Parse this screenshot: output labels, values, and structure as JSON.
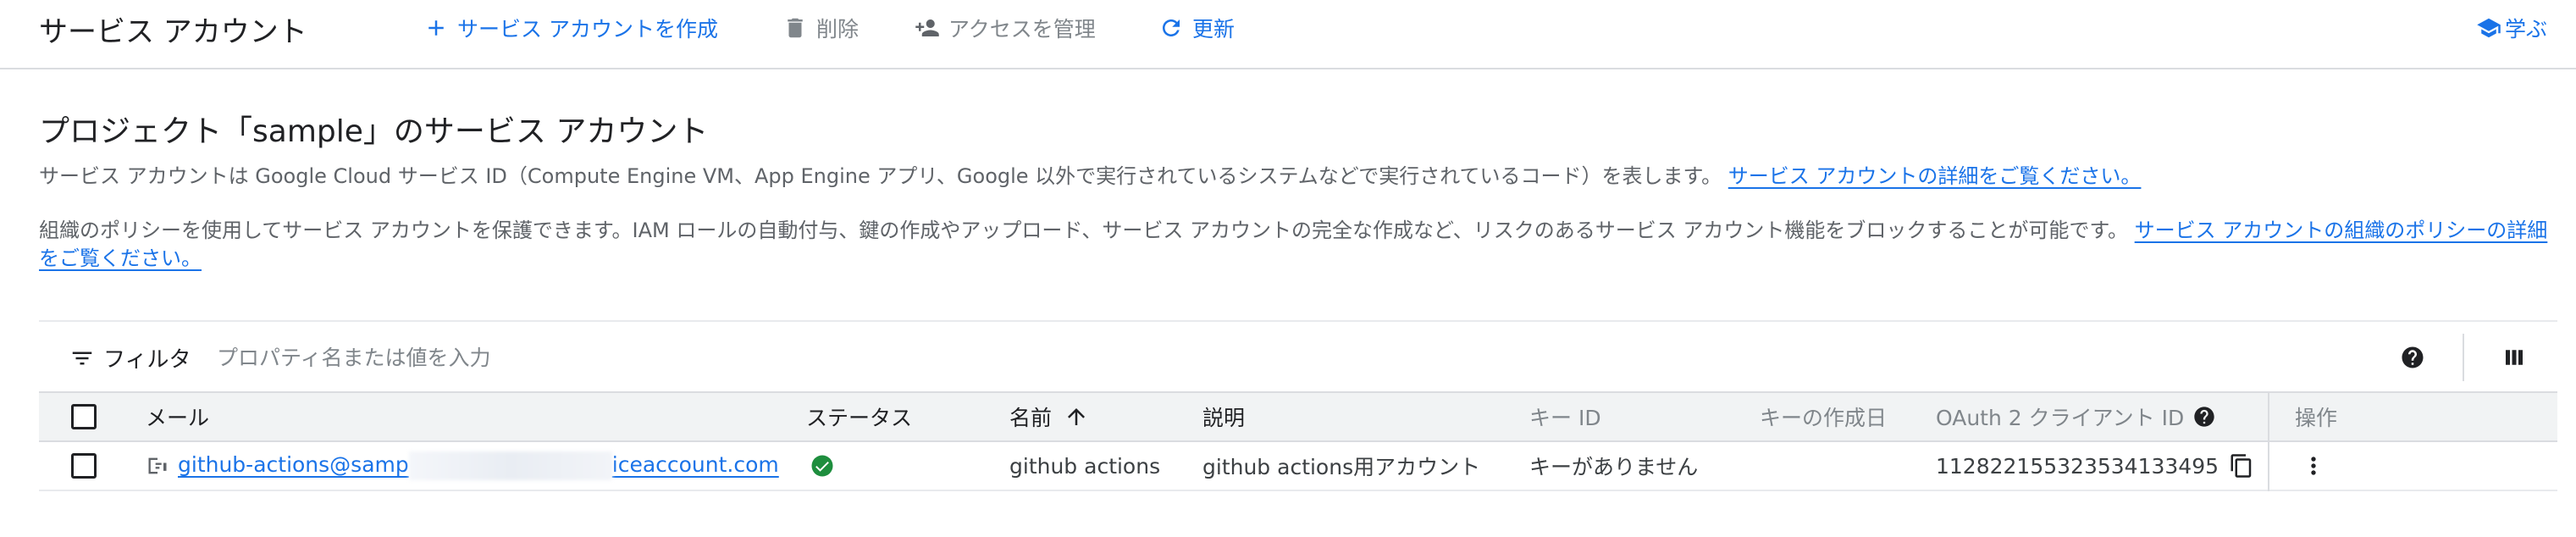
{
  "header": {
    "title": "サービス アカウント",
    "create_label": "サービス アカウントを作成",
    "delete_label": "削除",
    "manage_access_label": "アクセスを管理",
    "refresh_label": "更新",
    "learn_label": "学ぶ"
  },
  "main": {
    "heading": "プロジェクト「sample」のサービス アカウント",
    "description1": "サービス アカウントは Google Cloud サービス ID（Compute Engine VM、App Engine アプリ、Google 以外で実行されているシステムなどで実行されているコード）を表します。",
    "link1": "サービス アカウントの詳細をご覧ください。",
    "description2": "組織のポリシーを使用してサービス アカウントを保護できます。IAM ロールの自動付与、鍵の作成やアップロード、サービス アカウントの完全な作成など、リスクのあるサービス アカウント機能をブロックすることが可能です。",
    "link2": "サービス アカウントの組織のポリシーの詳細をご覧ください。"
  },
  "filter": {
    "label": "フィルタ",
    "placeholder": "プロパティ名または値を入力"
  },
  "table": {
    "columns": {
      "email": "メール",
      "status": "ステータス",
      "name": "名前",
      "description": "説明",
      "key_id": "キー ID",
      "key_created": "キーの作成日",
      "oauth_client_id": "OAuth 2 クライアント ID",
      "actions": "操作"
    },
    "rows": [
      {
        "email_start": "github-actions@samp",
        "email_end": "iceaccount.com",
        "status": "enabled",
        "name": "github actions",
        "description": "github actions用アカウント",
        "key_id": "キーがありません",
        "key_created": "",
        "oauth_client_id": "112822155323534133495"
      }
    ]
  },
  "colors": {
    "accent": "#1a73e8",
    "status_ok": "#1e8e3e",
    "muted": "#80868b",
    "border": "#dadce0"
  },
  "icons": [
    "add-icon",
    "trash-icon",
    "person-add-icon",
    "refresh-icon",
    "school-icon",
    "filter-icon",
    "help-icon",
    "columns-icon",
    "arrow-up-icon",
    "service-account-icon",
    "check-circle-icon",
    "copy-icon",
    "more-vert-icon"
  ]
}
